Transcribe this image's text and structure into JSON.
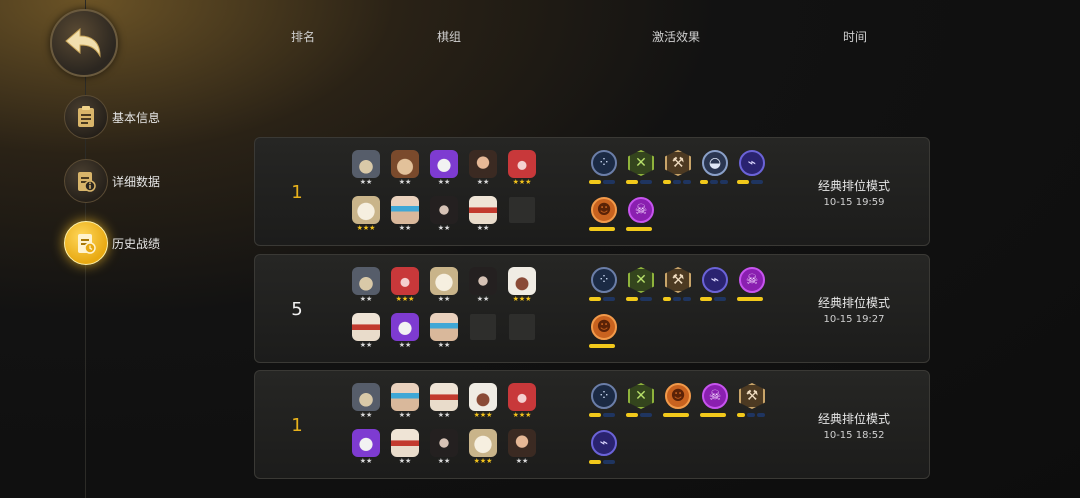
{
  "nav": {
    "items": [
      {
        "label": "基本信息",
        "icon": "clipboard-icon",
        "active": false
      },
      {
        "label": "详细数据",
        "icon": "data-sheet-icon",
        "active": false
      },
      {
        "label": "历史战绩",
        "icon": "history-record-icon",
        "active": true
      }
    ]
  },
  "columns": {
    "rank": "排名",
    "lineup": "棋组",
    "traits": "激活效果",
    "time": "时间"
  },
  "colors": {
    "gold": "#e8b21c",
    "bar_active": "#f2c91b",
    "bar_inactive": "#1f3560"
  },
  "matches": [
    {
      "rank": "1",
      "rank_color": "gold",
      "pieces_row1": [
        {
          "hero": "hooded-assassin",
          "stars": "★★",
          "star_level": 2
        },
        {
          "hero": "bear-warrior",
          "stars": "★★",
          "star_level": 2
        },
        {
          "hero": "purple-ghost",
          "stars": "★★",
          "star_level": 2
        },
        {
          "hero": "dwarf-warrior",
          "stars": "★★",
          "star_level": 2
        },
        {
          "hero": "red-beast",
          "stars": "★★★",
          "star_level": 3
        }
      ],
      "pieces_row2": [
        {
          "hero": "white-mage",
          "stars": "★★★",
          "star_level": 3
        },
        {
          "hero": "goggles-engineer",
          "stars": "★★",
          "star_level": 2
        },
        {
          "hero": "dark-knight",
          "stars": "★★",
          "star_level": 2
        },
        {
          "hero": "red-mask-monk",
          "stars": "★★",
          "star_level": 2
        },
        {
          "hero": "empty",
          "stars": "",
          "star_level": 0
        }
      ],
      "traits": [
        {
          "icon": "paw-icon",
          "shape": "circle",
          "fill": 1,
          "total": 2
        },
        {
          "icon": "cross-swords-icon",
          "shape": "hex",
          "fill": 1,
          "total": 2
        },
        {
          "icon": "axe-icon",
          "shape": "hex",
          "fill": 1,
          "total": 3
        },
        {
          "icon": "helmet-icon",
          "shape": "circle",
          "fill": 1,
          "total": 3
        },
        {
          "icon": "fish-bone-icon",
          "shape": "circle",
          "fill": 1,
          "total": 2
        },
        {
          "icon": "demon-icon",
          "shape": "circle",
          "fill": 1,
          "total": 1
        },
        {
          "icon": "skull-icon",
          "shape": "circle",
          "fill": 1,
          "total": 1
        }
      ],
      "mode": "经典排位模式",
      "time": "10-15 19:59"
    },
    {
      "rank": "5",
      "rank_color": "white",
      "pieces_row1": [
        {
          "hero": "hooded-assassin",
          "stars": "★★",
          "star_level": 2
        },
        {
          "hero": "red-beast",
          "stars": "★★★",
          "star_level": 3
        },
        {
          "hero": "white-mage",
          "stars": "★★",
          "star_level": 2
        },
        {
          "hero": "dark-knight",
          "stars": "★★",
          "star_level": 2
        },
        {
          "hero": "white-hair-warrior",
          "stars": "★★★",
          "star_level": 3
        }
      ],
      "pieces_row2": [
        {
          "hero": "red-mask-monk",
          "stars": "★★",
          "star_level": 2
        },
        {
          "hero": "purple-ghost",
          "stars": "★★",
          "star_level": 2
        },
        {
          "hero": "goggles-engineer",
          "stars": "★★",
          "star_level": 2
        },
        {
          "hero": "empty",
          "stars": "",
          "star_level": 0
        },
        {
          "hero": "empty",
          "stars": "",
          "star_level": 0
        }
      ],
      "traits": [
        {
          "icon": "paw-icon",
          "shape": "circle",
          "fill": 1,
          "total": 2
        },
        {
          "icon": "cross-swords-icon",
          "shape": "hex",
          "fill": 1,
          "total": 2
        },
        {
          "icon": "axe-icon",
          "shape": "hex",
          "fill": 1,
          "total": 3
        },
        {
          "icon": "fish-bone-icon",
          "shape": "circle",
          "fill": 1,
          "total": 2
        },
        {
          "icon": "skull-icon",
          "shape": "circle",
          "fill": 1,
          "total": 1
        },
        {
          "icon": "demon-icon",
          "shape": "circle",
          "fill": 1,
          "total": 1
        }
      ],
      "mode": "经典排位模式",
      "time": "10-15 19:27"
    },
    {
      "rank": "1",
      "rank_color": "gold",
      "pieces_row1": [
        {
          "hero": "hooded-assassin",
          "stars": "★★",
          "star_level": 2
        },
        {
          "hero": "goggles-engineer",
          "stars": "★★",
          "star_level": 2
        },
        {
          "hero": "red-mask-monk",
          "stars": "★★",
          "star_level": 2
        },
        {
          "hero": "white-hair-warrior",
          "stars": "★★★",
          "star_level": 3
        },
        {
          "hero": "red-beast",
          "stars": "★★★",
          "star_level": 3
        }
      ],
      "pieces_row2": [
        {
          "hero": "purple-ghost",
          "stars": "★★",
          "star_level": 2
        },
        {
          "hero": "red-mask-monk",
          "stars": "★★",
          "star_level": 2
        },
        {
          "hero": "dark-knight",
          "stars": "★★",
          "star_level": 2
        },
        {
          "hero": "white-mage",
          "stars": "★★★",
          "star_level": 3
        },
        {
          "hero": "dwarf-warrior",
          "stars": "★★",
          "star_level": 2
        }
      ],
      "traits": [
        {
          "icon": "paw-icon",
          "shape": "circle",
          "fill": 1,
          "total": 2
        },
        {
          "icon": "cross-swords-icon",
          "shape": "hex",
          "fill": 1,
          "total": 2
        },
        {
          "icon": "demon-icon",
          "shape": "circle",
          "fill": 1,
          "total": 1
        },
        {
          "icon": "skull-icon",
          "shape": "circle",
          "fill": 1,
          "total": 1
        },
        {
          "icon": "axe-icon",
          "shape": "hex",
          "fill": 1,
          "total": 3
        },
        {
          "icon": "fish-bone-icon",
          "shape": "circle",
          "fill": 1,
          "total": 2
        }
      ],
      "mode": "经典排位模式",
      "time": "10-15 18:52"
    }
  ]
}
